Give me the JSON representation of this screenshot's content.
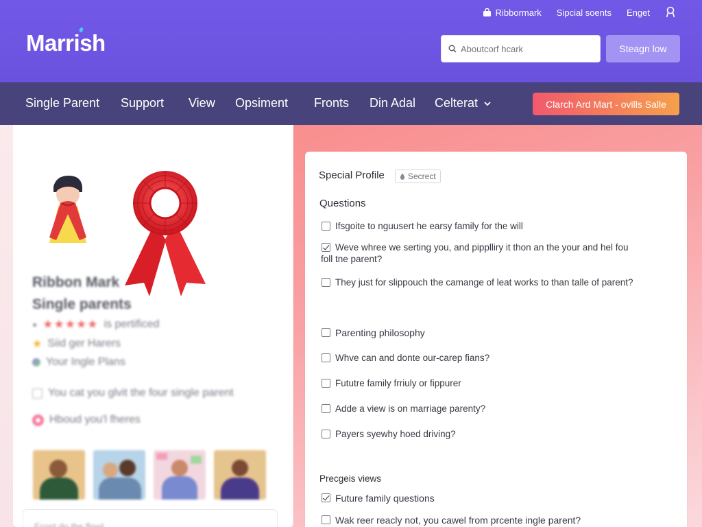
{
  "header": {
    "logo": "Marrish",
    "top_links": [
      {
        "label": "Ribbormark",
        "icon": "bag-icon"
      },
      {
        "label": "Sipcial soents",
        "icon": ""
      },
      {
        "label": "Enget",
        "icon": ""
      }
    ],
    "search_placeholder": "Aboutcorf hcark",
    "search_button": "Steagn low"
  },
  "nav": {
    "items": [
      "Single Parent",
      "Support",
      "View",
      "Opsiment",
      "Fronts",
      "Din Adal",
      "Celterat"
    ],
    "cta": "Clarch Ard Mart - ovills Salle"
  },
  "left_panel": {
    "title_line1": "Ribbon Mark",
    "title_line2": "Single parents",
    "rating_text": "is pertificed",
    "row2": "Siid ger Harers",
    "row3": "Your Ingle Plans",
    "check_text": "You cat you glvit the four single parent",
    "radio_text": "Hboud you'l fheres",
    "footer_text": "Fcost do the flowl"
  },
  "profile": {
    "title": "Special Profile",
    "badge": "Secrect",
    "questions_heading": "Questions",
    "questions": [
      {
        "text": "Ifsgoite to nguusert he earsy family for the will",
        "checked": false
      },
      {
        "text": "Weve whree we serting you, and pipplliry it thon an the your and hel fou",
        "checked": true,
        "cont": "foll tne parent?"
      },
      {
        "text": "They just for slippouch the camange of leat works to than talle of parent?",
        "checked": false
      }
    ],
    "topics": [
      {
        "text": "Parenting philosophy",
        "checked": false
      },
      {
        "text": "Whve can and donte our-carep fians?",
        "checked": false
      },
      {
        "text": "Fututre family frriuly or fippurer",
        "checked": false
      },
      {
        "text": "Adde a view is on marriage parenty?",
        "checked": false
      },
      {
        "text": "Payers syewhy hoed driving?",
        "checked": false
      }
    ],
    "views_heading": "Precgeis views",
    "views": [
      {
        "text": "Future family questions",
        "checked": true
      },
      {
        "text": "Wak reer reacly not, you cawel from prcente ingle parent?",
        "checked": false
      }
    ]
  }
}
